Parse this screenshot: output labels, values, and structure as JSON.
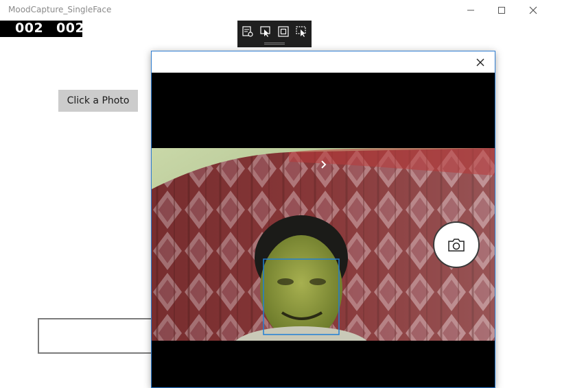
{
  "window": {
    "title": "MoodCapture_SingleFace",
    "controls": [
      "minimize-icon",
      "maximize-icon",
      "close-icon"
    ]
  },
  "frame_counter": {
    "left": "002",
    "right": "002"
  },
  "debug_toolbar": {
    "icons": [
      "visual-tree-icon",
      "select-element-icon",
      "display-layout-adorners-icon",
      "track-focused-element-icon"
    ]
  },
  "main": {
    "photo_button_label": "Click a Photo",
    "text_box_value": ""
  },
  "camera_dialog": {
    "close_icon": "close-icon",
    "expand_icon": "chevron-right-icon",
    "shutter_icon": "camera-icon",
    "accent_color": "#2b7bd0",
    "face_box_color": "#1f7fd6"
  }
}
